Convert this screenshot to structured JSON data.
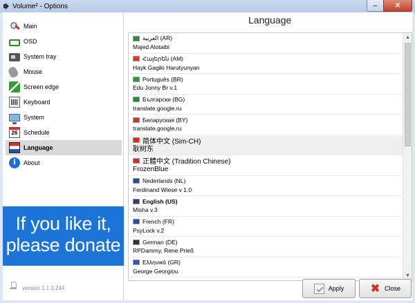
{
  "window": {
    "title": "Volume² - Options"
  },
  "sidebar": {
    "items": [
      {
        "label": "Main",
        "icon": "main-icon"
      },
      {
        "label": "OSD",
        "icon": "osd-icon"
      },
      {
        "label": "System tray",
        "icon": "tray-icon"
      },
      {
        "label": "Mouse",
        "icon": "mouse-icon"
      },
      {
        "label": "Screen edge",
        "icon": "screen-edge-icon"
      },
      {
        "label": "Keyboard",
        "icon": "keyboard-icon"
      },
      {
        "label": "System",
        "icon": "system-icon"
      },
      {
        "label": "Schedule",
        "icon": "calendar-icon",
        "icon_text": "26"
      },
      {
        "label": "Language",
        "icon": "flag-icon",
        "active": true
      },
      {
        "label": "About",
        "icon": "info-icon",
        "icon_text": "i"
      }
    ],
    "donate": {
      "line1": "If you like it,",
      "line2": "please donate"
    },
    "version": "version 1.1.3.244"
  },
  "language": {
    "heading": "Language",
    "languages": [
      {
        "name": "العربية (AR)",
        "author": "Majed Alotaibi",
        "flag": "#2f8a3a"
      },
      {
        "name": "Հայերեն (AM)",
        "author": "Hayk Gagiki Harutyunyan",
        "flag": "#d83a2a"
      },
      {
        "name": "Português (BR)",
        "author": "Edu Jonny Br v.1",
        "flag": "#2a9a3a"
      },
      {
        "name": "Български (BG)",
        "author": "translate.google.ru",
        "flag": "#2a8a4a"
      },
      {
        "name": "Беларуская (BY)",
        "author": "translate.google.ru",
        "flag": "#c33a2a"
      },
      {
        "name": "简体中文 (Sim-CH)",
        "author": "耿树东",
        "flag": "#de2910",
        "selected": true,
        "big": true
      },
      {
        "name": "正體中文 (Tradition Chinese)",
        "author": "FrozenBlue",
        "flag": "#d82a2a",
        "big": true
      },
      {
        "name": "Nederlands (NL)",
        "author": "Ferdinand Wiese v 1.0",
        "flag": "#2a4a9a"
      },
      {
        "name": "English (US)",
        "author": "Misha v.3",
        "flag": "#3c3b6e",
        "bold": true
      },
      {
        "name": "French (FR)",
        "author": "PsyLock v.2",
        "flag": "#2a4ab0"
      },
      {
        "name": "German (DE)",
        "author": "RPDammy, Rene Prieß",
        "flag": "#333333"
      },
      {
        "name": "Ελληνικά (GR)",
        "author": "George Georgiou",
        "flag": "#2a5ab0"
      }
    ]
  },
  "buttons": {
    "apply": "Apply",
    "close": "Close"
  },
  "window_controls": {
    "minimize": "–",
    "close": "✕"
  },
  "scroll": {
    "up": "▲",
    "down": "▼"
  }
}
